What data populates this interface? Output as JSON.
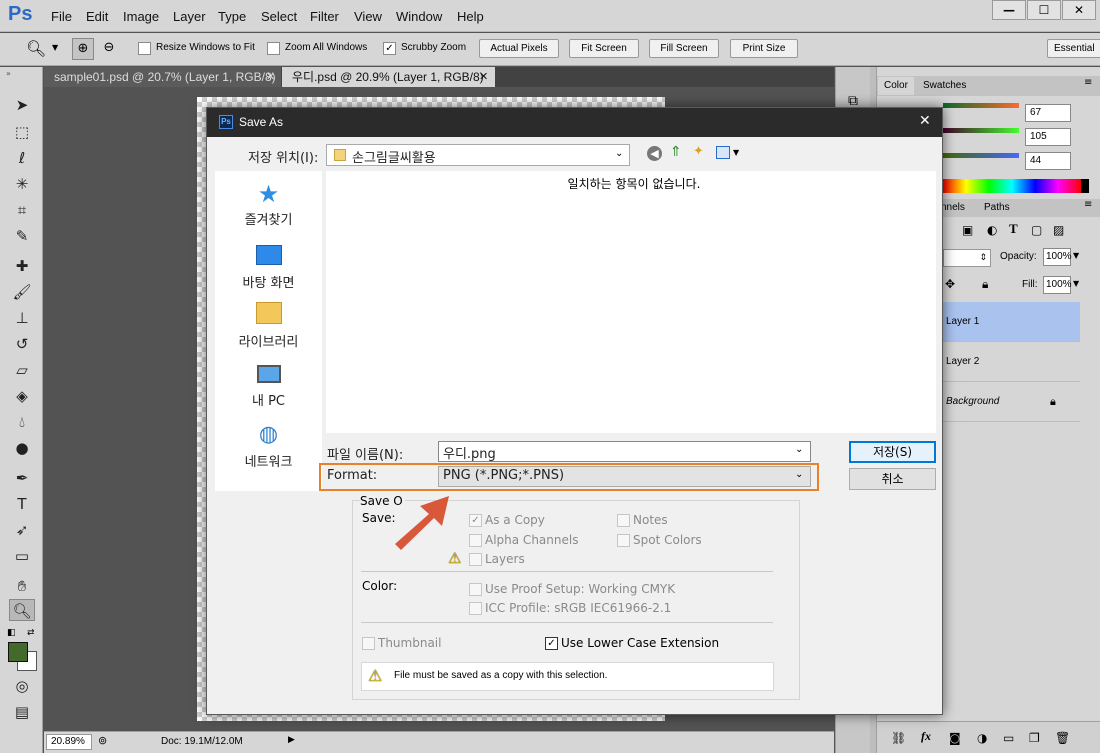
{
  "app": {
    "logo": "Ps",
    "menus": [
      "File",
      "Edit",
      "Image",
      "Layer",
      "Type",
      "Select",
      "Filter",
      "View",
      "Window",
      "Help"
    ],
    "window_controls": {
      "minimize": "—",
      "maximize": "☐",
      "close": "✕"
    }
  },
  "options_bar": {
    "resize_windows": "Resize Windows to Fit",
    "zoom_all": "Zoom All Windows",
    "scrubby_zoom": "Scrubby Zoom",
    "actual_pixels": "Actual Pixels",
    "fit_screen": "Fit Screen",
    "fill_screen": "Fill Screen",
    "print_size": "Print Size",
    "workspace": "Essential"
  },
  "tabs": [
    {
      "label": "sample01.psd @ 20.7% (Layer 1, RGB/8)"
    },
    {
      "label": "우디.psd @ 20.9% (Layer 1, RGB/8)"
    }
  ],
  "status": {
    "zoom": "20.89%",
    "doc": "Doc: 19.1M/12.0M"
  },
  "color_panel": {
    "tab_color": "Color",
    "tab_swatches": "Swatches",
    "r": "67",
    "g": "105",
    "b": "44"
  },
  "layers_panel": {
    "tab_channels": "nnels",
    "tab_paths": "Paths",
    "opacity_label": "Opacity:",
    "opacity": "100%",
    "fill_label": "Fill:",
    "fill": "100%",
    "layers": [
      "Layer 1",
      "Layer 2",
      "Background"
    ]
  },
  "dialog": {
    "title": "Save As",
    "location_label": "저장 위치(I):",
    "location": "손그림글씨활용",
    "empty_msg": "일치하는 항목이 없습니다.",
    "places": [
      "즐겨찾기",
      "바탕 화면",
      "라이브러리",
      "내 PC",
      "네트워크"
    ],
    "filename_label": "파일 이름(N):",
    "filename": "우디.png",
    "format_label": "Format:",
    "format": "PNG (*.PNG;*.PNS)",
    "save_button": "저장(S)",
    "cancel_button": "취소",
    "save_options_label": "Save O",
    "save_label": "Save:",
    "as_copy": "As a Copy",
    "notes": "Notes",
    "alpha_channels": "Alpha Channels",
    "spot_colors": "Spot Colors",
    "layers": "Layers",
    "color_label": "Color:",
    "use_proof": "Use Proof Setup:  Working CMYK",
    "icc_profile": "ICC Profile:  sRGB IEC61966-2.1",
    "thumbnail": "Thumbnail",
    "lower_case": "Use Lower Case Extension",
    "warning": "File must be saved as a copy with this selection."
  },
  "colors": {
    "accent_orange": "#e8822a",
    "arrow": "#d9583a",
    "fg_swatch": "#43692c"
  }
}
